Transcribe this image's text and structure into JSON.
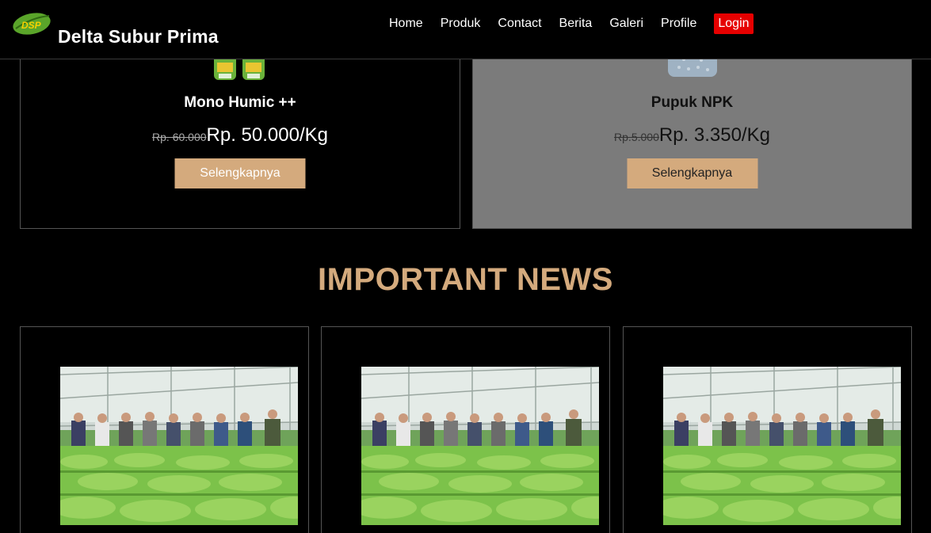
{
  "brand": {
    "name": "Delta Subur Prima",
    "logo_text": "DSP"
  },
  "nav": {
    "items": [
      "Home",
      "Produk",
      "Contact",
      "Berita",
      "Galeri",
      "Profile"
    ],
    "login": "Login"
  },
  "products": [
    {
      "name": "Mono Humic ++",
      "old_price": "Rp. 60.000",
      "price": "Rp. 50.000/Kg",
      "button": "Selengkapnya"
    },
    {
      "name": "Pupuk NPK",
      "old_price": "Rp.5.000",
      "price": "Rp. 3.350/Kg",
      "button": "Selengkapnya"
    }
  ],
  "news": {
    "title": "IMPORTANT NEWS",
    "cards": [
      {
        "image": "news-photo"
      },
      {
        "image": "news-photo"
      },
      {
        "image": "news-photo"
      }
    ]
  },
  "colors": {
    "accent": "#d4aa7d",
    "login_bg": "#e60000",
    "card_gray": "#7b7b7b"
  }
}
